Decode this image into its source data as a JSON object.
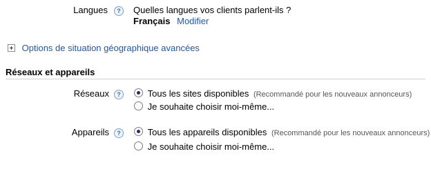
{
  "languages": {
    "label": "Langues",
    "question": "Quelles langues vos clients parlent-ils ?",
    "selected": "Français",
    "modify_link": "Modifier"
  },
  "advanced_location": {
    "label": "Options de situation géographique avancées"
  },
  "networks_devices": {
    "title": "Réseaux et appareils",
    "networks": {
      "label": "Réseaux",
      "options": [
        {
          "label": "Tous les sites disponibles",
          "note": "(Recommandé pour les nouveaux annonceurs)",
          "checked": true
        },
        {
          "label": "Je souhaite choisir moi-même...",
          "note": "",
          "checked": false
        }
      ]
    },
    "devices": {
      "label": "Appareils",
      "options": [
        {
          "label": "Tous les appareils disponibles",
          "note": "(Recommandé pour les nouveaux annonceurs)",
          "checked": true
        },
        {
          "label": "Je souhaite choisir moi-même...",
          "note": "",
          "checked": false
        }
      ]
    }
  }
}
